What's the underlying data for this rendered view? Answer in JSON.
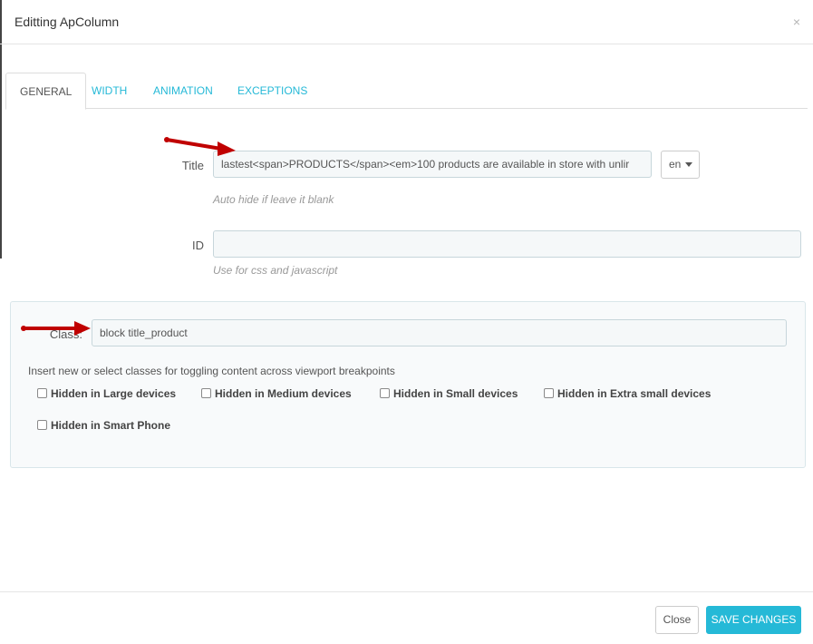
{
  "dialog": {
    "title": "Editting ApColumn",
    "close_icon": "×"
  },
  "tabs": [
    {
      "label": "GENERAL",
      "active": true
    },
    {
      "label": "WIDTH",
      "active": false
    },
    {
      "label": "ANIMATION",
      "active": false
    },
    {
      "label": "EXCEPTIONS",
      "active": false
    }
  ],
  "form": {
    "title": {
      "label": "Title",
      "value": "lastest<span>PRODUCTS</span><em>100  products are available in store with unlir",
      "help": "Auto hide if leave it blank",
      "language": "en"
    },
    "id": {
      "label": "ID",
      "value": "",
      "help": "Use for css and javascript"
    },
    "class": {
      "label": "Class:",
      "value": "block title_product"
    },
    "note": "Insert new or select classes for toggling content across viewport breakpoints",
    "checkboxes": [
      {
        "label": "Hidden in Large devices",
        "checked": false
      },
      {
        "label": "Hidden in Medium devices",
        "checked": false
      },
      {
        "label": "Hidden in Small devices",
        "checked": false
      },
      {
        "label": "Hidden in Extra small devices",
        "checked": false
      },
      {
        "label": "Hidden in Smart Phone",
        "checked": false
      }
    ]
  },
  "footer": {
    "close_label": "Close",
    "save_label": "SAVE CHANGES"
  },
  "colors": {
    "accent": "#25b9d7",
    "annotation_arrow": "#c00000"
  }
}
